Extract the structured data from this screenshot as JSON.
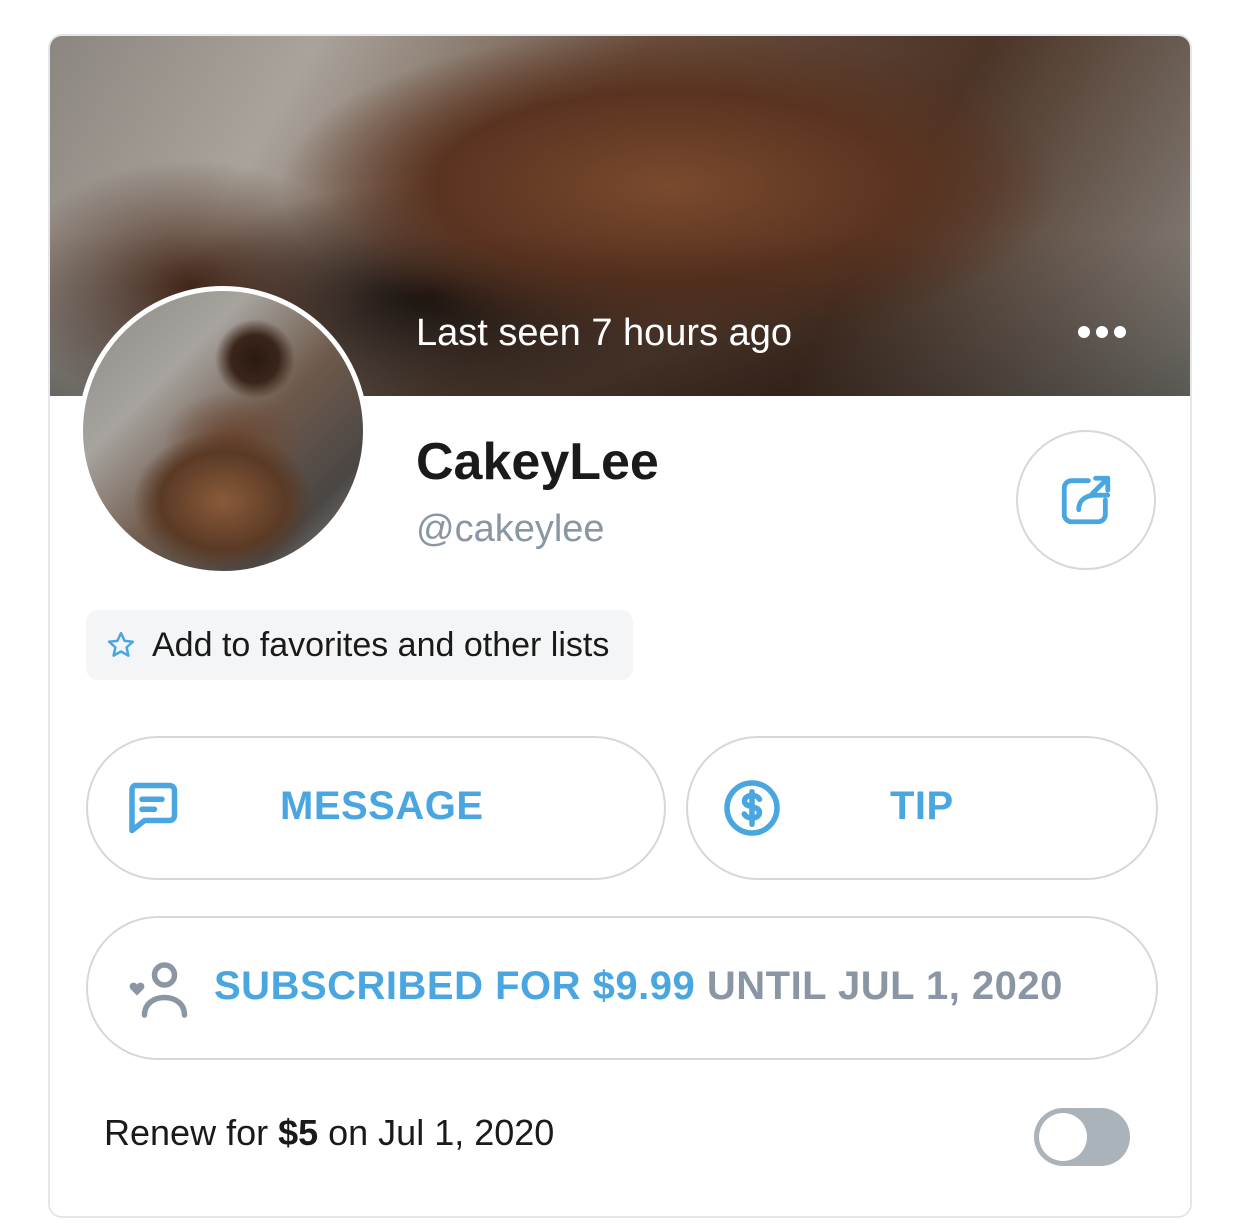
{
  "cover": {
    "last_seen": "Last seen 7 hours ago"
  },
  "profile": {
    "name": "CakeyLee",
    "handle": "@cakeylee"
  },
  "favorites": {
    "label": "Add to favorites and other lists"
  },
  "actions": {
    "message_label": "MESSAGE",
    "tip_label": "TIP"
  },
  "subscription": {
    "status_label": "SUBSCRIBED FOR $9.99",
    "until_label": "UNTIL JUL 1, 2020"
  },
  "renew": {
    "prefix": "Renew for ",
    "price": "$5",
    "suffix": " on Jul 1, 2020",
    "auto_renew_on": false
  },
  "colors": {
    "accent": "#4aa6e0",
    "muted": "#8a96a3",
    "toggle_off": "#aab2ba"
  },
  "icons": [
    "more-icon",
    "share-icon",
    "star-icon",
    "message-icon",
    "dollar-icon",
    "subscribe-user-icon"
  ]
}
